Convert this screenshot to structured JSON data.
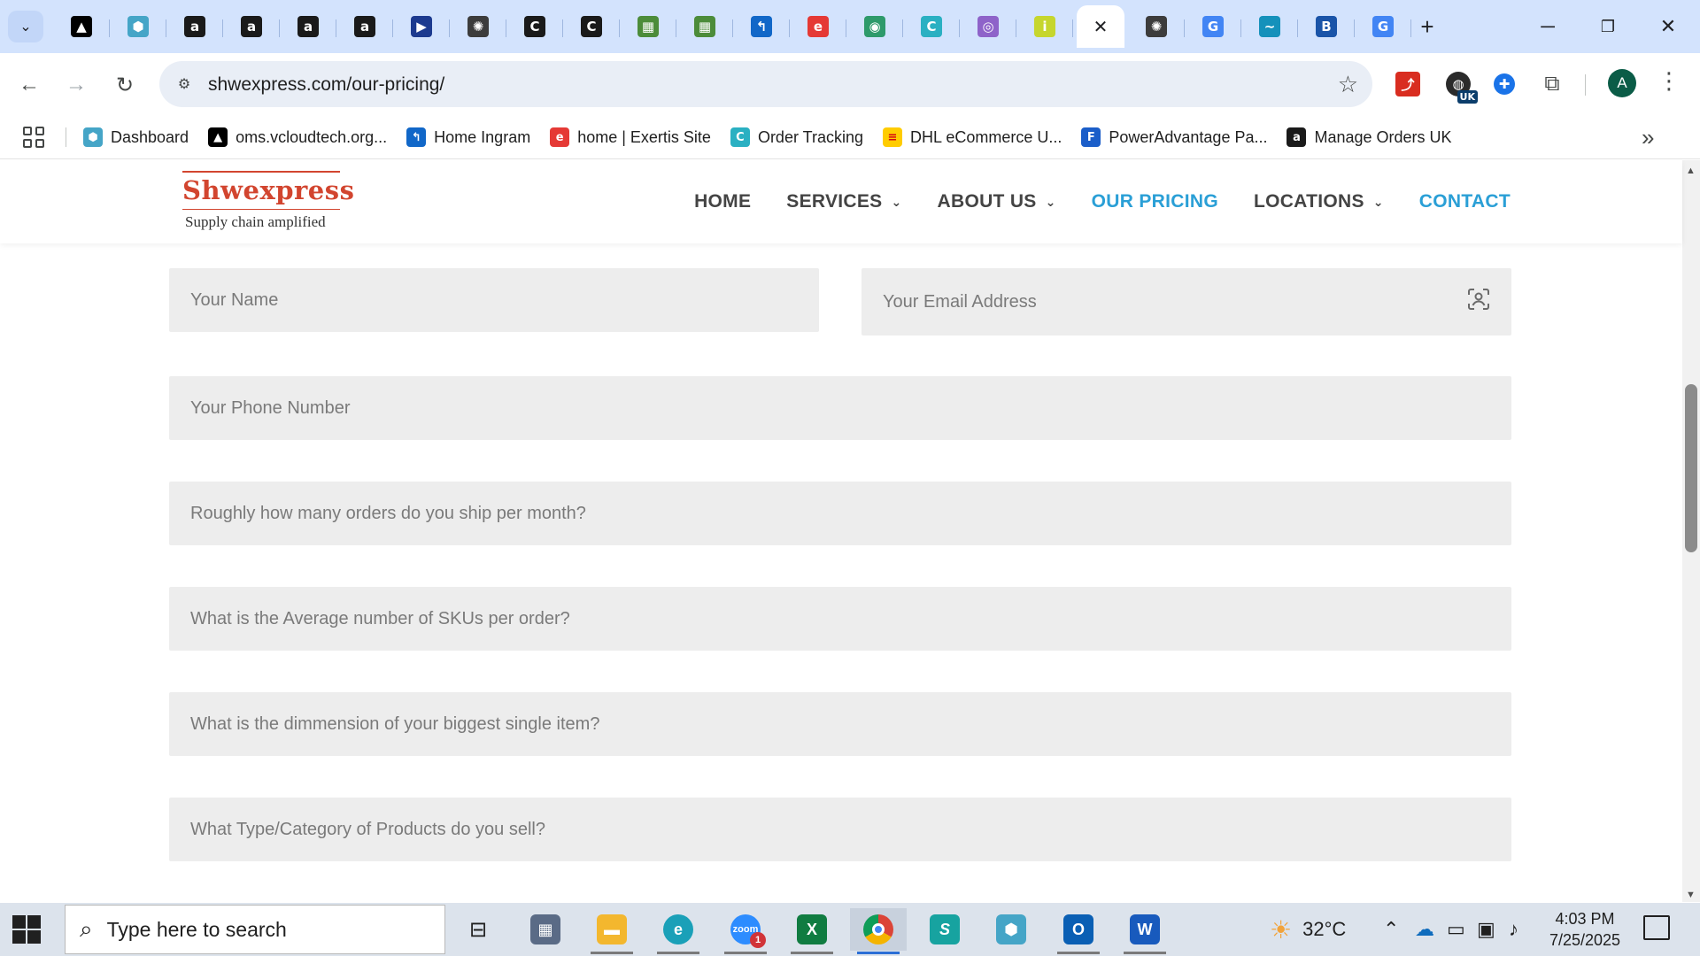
{
  "browser": {
    "tabs": [
      {
        "icon": "amplience-icon",
        "glyph": "▲",
        "bg": "#000000"
      },
      {
        "icon": "hex-icon",
        "glyph": "⬢",
        "bg": "#45a5c7"
      },
      {
        "icon": "amazon-icon",
        "glyph": "a",
        "bg": "#1a1a1a"
      },
      {
        "icon": "amazon-icon",
        "glyph": "a",
        "bg": "#1a1a1a"
      },
      {
        "icon": "amazon-icon",
        "glyph": "a",
        "bg": "#1a1a1a"
      },
      {
        "icon": "amazon-icon",
        "glyph": "a",
        "bg": "#1a1a1a"
      },
      {
        "icon": "arrow-play-icon",
        "glyph": "▶",
        "bg": "#1c3a8f"
      },
      {
        "icon": "chatgpt-icon",
        "glyph": "✺",
        "bg": "#3c3c3c"
      },
      {
        "icon": "c-logo-icon",
        "glyph": "C",
        "bg": "#1a1a1a"
      },
      {
        "icon": "c-logo-icon",
        "glyph": "C",
        "bg": "#1a1a1a"
      },
      {
        "icon": "sheet-icon",
        "glyph": "▦",
        "bg": "#4c8c3a"
      },
      {
        "icon": "sheet-icon",
        "glyph": "▦",
        "bg": "#4c8c3a"
      },
      {
        "icon": "ingram-icon",
        "glyph": "↰",
        "bg": "#1167c8"
      },
      {
        "icon": "exertis-icon",
        "glyph": "e",
        "bg": "#e53935"
      },
      {
        "icon": "leaf-icon",
        "glyph": "◉",
        "bg": "#2e9a6b"
      },
      {
        "icon": "c-swirl-icon",
        "glyph": "C",
        "bg": "#2ab0c2"
      },
      {
        "icon": "signal-icon",
        "glyph": "◎",
        "bg": "#8e63c9"
      },
      {
        "icon": "infos-icon",
        "glyph": "i",
        "bg": "#c6d62d"
      },
      {
        "icon": "close-icon",
        "glyph": "✕",
        "bg": "transparent",
        "active": true
      },
      {
        "icon": "chatgpt-icon",
        "glyph": "✺",
        "bg": "#3c3c3c"
      },
      {
        "icon": "google-icon",
        "glyph": "G",
        "bg": "#4285f4"
      },
      {
        "icon": "wave-icon",
        "glyph": "∼",
        "bg": "#1591bb"
      },
      {
        "icon": "bs-icon",
        "glyph": "B",
        "bg": "#1a54a8"
      },
      {
        "icon": "google-icon",
        "glyph": "G",
        "bg": "#4285f4"
      }
    ],
    "url": "shwexpress.com/our-pricing/",
    "bookmarks": [
      {
        "label": "Dashboard",
        "icon": "hex-icon",
        "glyph": "⬢",
        "bg": "#45a5c7"
      },
      {
        "label": "oms.vcloudtech.org...",
        "icon": "amplience-icon",
        "glyph": "▲",
        "bg": "#000000"
      },
      {
        "label": "Home Ingram",
        "icon": "ingram-icon",
        "glyph": "↰",
        "bg": "#1167c8"
      },
      {
        "label": "home | Exertis Site",
        "icon": "exertis-icon",
        "glyph": "e",
        "bg": "#e53935"
      },
      {
        "label": "Order Tracking",
        "icon": "c-swirl-icon",
        "glyph": "C",
        "bg": "#2ab0c2"
      },
      {
        "label": "DHL eCommerce U...",
        "icon": "dhl-icon",
        "glyph": "≡",
        "bg": "#ffcc00"
      },
      {
        "label": "PowerAdvantage Pa...",
        "icon": "doc-icon",
        "glyph": "F",
        "bg": "#1b5ec9"
      },
      {
        "label": "Manage Orders UK",
        "icon": "amazon-icon",
        "glyph": "a",
        "bg": "#1a1a1a"
      }
    ],
    "avatar_letter": "A",
    "ext_badge": "UK"
  },
  "site": {
    "logo_name": "Shwexpress",
    "logo_tagline": "Supply chain amplified",
    "nav": [
      {
        "label": "HOME",
        "dropdown": false,
        "active": false
      },
      {
        "label": "SERVICES",
        "dropdown": true,
        "active": false
      },
      {
        "label": "ABOUT US",
        "dropdown": true,
        "active": false
      },
      {
        "label": "OUR PRICING",
        "dropdown": false,
        "active": true
      },
      {
        "label": "LOCATIONS",
        "dropdown": true,
        "active": false
      },
      {
        "label": "CONTACT",
        "dropdown": false,
        "active": true
      }
    ],
    "accent": "#2a9fd6",
    "brand": "#d2452f"
  },
  "form": {
    "name_placeholder": "Your Name",
    "email_placeholder": "Your Email Address",
    "phone_placeholder": "Your Phone Number",
    "orders_placeholder": "Roughly how many orders do you ship per month?",
    "skus_placeholder": "What is the Average number of SKUs per order?",
    "dimension_placeholder": "What is the dimmension of your biggest single item?",
    "category_placeholder": "What Type/Category of Products do you sell?"
  },
  "taskbar": {
    "search_placeholder": "Type here to search",
    "zoom_badge": "1",
    "weather": "32°C",
    "time": "4:03 PM",
    "date": "7/25/2025"
  }
}
